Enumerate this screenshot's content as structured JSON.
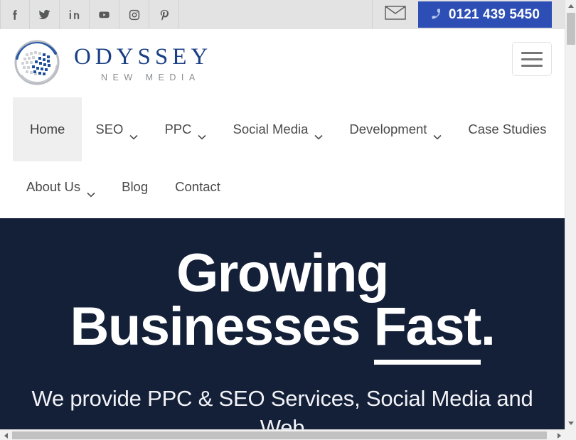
{
  "colors": {
    "topbar_bg": "#e3e3e3",
    "phone_button_bg": "#2d4fb5",
    "hero_bg": "#141f38",
    "brand_blue": "#1b3f84",
    "brand_gray": "#8b8d90",
    "nav_text": "#4a4a4a",
    "active_nav_bg": "#efefef"
  },
  "topbar": {
    "social": [
      {
        "name": "facebook-icon",
        "label": "Facebook"
      },
      {
        "name": "twitter-icon",
        "label": "Twitter"
      },
      {
        "name": "linkedin-icon",
        "label": "LinkedIn"
      },
      {
        "name": "youtube-icon",
        "label": "YouTube"
      },
      {
        "name": "instagram-icon",
        "label": "Instagram"
      },
      {
        "name": "pinterest-icon",
        "label": "Pinterest"
      }
    ],
    "email_icon": "envelope-icon",
    "phone_icon": "phone-icon",
    "phone_number": "0121 439 5450"
  },
  "header": {
    "logo_title": "ODYSSEY",
    "logo_subtitle": "NEW MEDIA",
    "logo_icon": "globe-sphere-logo",
    "menu_toggle_icon": "hamburger-icon"
  },
  "nav": {
    "row1": [
      {
        "label": "Home",
        "has_caret": false,
        "active": true
      },
      {
        "label": "SEO",
        "has_caret": true,
        "active": false
      },
      {
        "label": "PPC",
        "has_caret": true,
        "active": false
      },
      {
        "label": "Social Media",
        "has_caret": true,
        "active": false
      },
      {
        "label": "Development",
        "has_caret": true,
        "active": false
      },
      {
        "label": "Case Studies",
        "has_caret": false,
        "active": false
      }
    ],
    "row2": [
      {
        "label": "About Us",
        "has_caret": true,
        "active": false
      },
      {
        "label": "Blog",
        "has_caret": false,
        "active": false
      },
      {
        "label": "Contact",
        "has_caret": false,
        "active": false
      }
    ]
  },
  "hero": {
    "heading_line1": "Growing",
    "heading_line2_plain": "Businesses ",
    "heading_line2_underlined": "Fast",
    "heading_line2_period": ".",
    "subtext": "We provide PPC & SEO Services, Social Media and Web"
  },
  "scrollbars": {
    "vertical_up_icon": "scroll-up-arrow",
    "vertical_down_icon": "scroll-down-arrow",
    "horizontal_left_icon": "scroll-left-arrow",
    "horizontal_right_icon": "scroll-right-arrow"
  }
}
